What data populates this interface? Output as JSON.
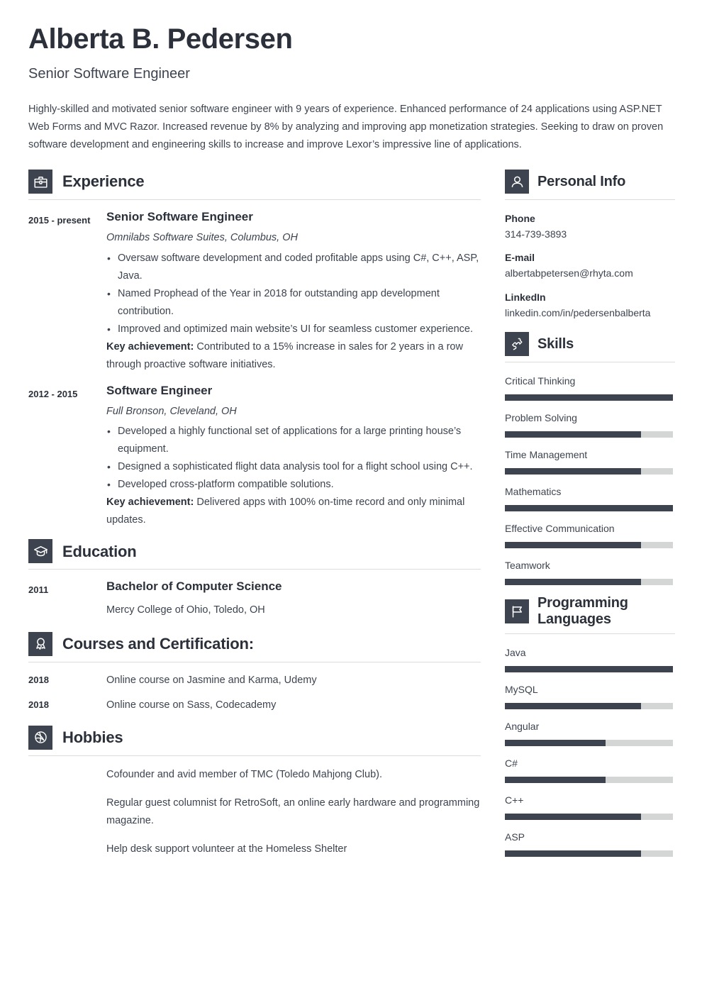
{
  "header": {
    "name": "Alberta B. Pedersen",
    "job_title": "Senior Software Engineer",
    "summary": "Highly-skilled and motivated senior software engineer with 9 years of experience. Enhanced performance of 24 applications using ASP.NET Web Forms and MVC Razor. Increased revenue by 8% by analyzing and improving app monetization strategies. Seeking to draw on proven software development and engineering skills to increase and improve Lexor’s impressive line of applications."
  },
  "colors": {
    "accent": "#3d4450",
    "heading": "#2b303a",
    "bar_track": "#d4d5d5",
    "rule": "#dcdcdc"
  },
  "experience": {
    "title": "Experience",
    "icon": "briefcase-icon",
    "entries": [
      {
        "date": "2015 - present",
        "role": "Senior Software Engineer",
        "company": "Omnilabs Software Suites, Columbus, OH",
        "bullets": [
          "Oversaw software development and coded profitable apps using C#, C++, ASP, Java.",
          "Named Prophead of the Year in 2018 for outstanding app development contribution.",
          "Improved and optimized main website’s UI for seamless customer experience."
        ],
        "key_label": "Key achievement:",
        "key_text": "Contributed to a 15% increase in sales for 2 years in a row through proactive software initiatives."
      },
      {
        "date": "2012 - 2015",
        "role": "Software Engineer",
        "company": "Full Bronson, Cleveland, OH",
        "bullets": [
          "Developed a highly functional set of applications for a large printing house’s equipment.",
          "Designed a sophisticated flight data analysis tool for a flight school using C++.",
          "Developed cross-platform compatible solutions."
        ],
        "key_label": "Key achievement:",
        "key_text": "Delivered apps with 100% on-time record and only minimal updates."
      }
    ]
  },
  "education": {
    "title": "Education",
    "icon": "graduation-cap-icon",
    "entries": [
      {
        "date": "2011",
        "degree": "Bachelor of Computer Science",
        "school": "Mercy College of Ohio, Toledo, OH"
      }
    ]
  },
  "courses": {
    "title": "Courses and Certification:",
    "icon": "award-ribbon-icon",
    "entries": [
      {
        "date": "2018",
        "text": "Online course on Jasmine and Karma, Udemy"
      },
      {
        "date": "2018",
        "text": "Online course on Sass, Codecademy"
      }
    ]
  },
  "hobbies": {
    "title": "Hobbies",
    "icon": "basketball-icon",
    "items": [
      "Cofounder and avid member of TMC (Toledo Mahjong Club).",
      "Regular guest columnist for RetroSoft, an online early hardware and programming magazine.",
      "Help desk support volunteer at the Homeless Shelter"
    ]
  },
  "personal_info": {
    "title": "Personal Info",
    "icon": "person-icon",
    "fields": [
      {
        "label": "Phone",
        "value": "314-739-3893"
      },
      {
        "label": "E-mail",
        "value": "albertabpetersen@rhyta.com"
      },
      {
        "label": "LinkedIn",
        "value": "linkedin.com/in/pedersenbalberta"
      }
    ]
  },
  "skills": {
    "title": "Skills",
    "icon": "puzzle-piece-icon",
    "items": [
      {
        "name": "Critical Thinking",
        "level": 100
      },
      {
        "name": "Problem Solving",
        "level": 81
      },
      {
        "name": "Time Management",
        "level": 81
      },
      {
        "name": "Mathematics",
        "level": 100
      },
      {
        "name": "Effective Communication",
        "level": 81
      },
      {
        "name": "Teamwork",
        "level": 81
      }
    ]
  },
  "programming_languages": {
    "title_line1": "Programming",
    "title_line2": "Languages",
    "icon": "flag-icon",
    "items": [
      {
        "name": "Java",
        "level": 100
      },
      {
        "name": "MySQL",
        "level": 81
      },
      {
        "name": "Angular",
        "level": 60
      },
      {
        "name": "C#",
        "level": 60
      },
      {
        "name": "C++",
        "level": 81
      },
      {
        "name": "ASP",
        "level": 81
      }
    ]
  }
}
